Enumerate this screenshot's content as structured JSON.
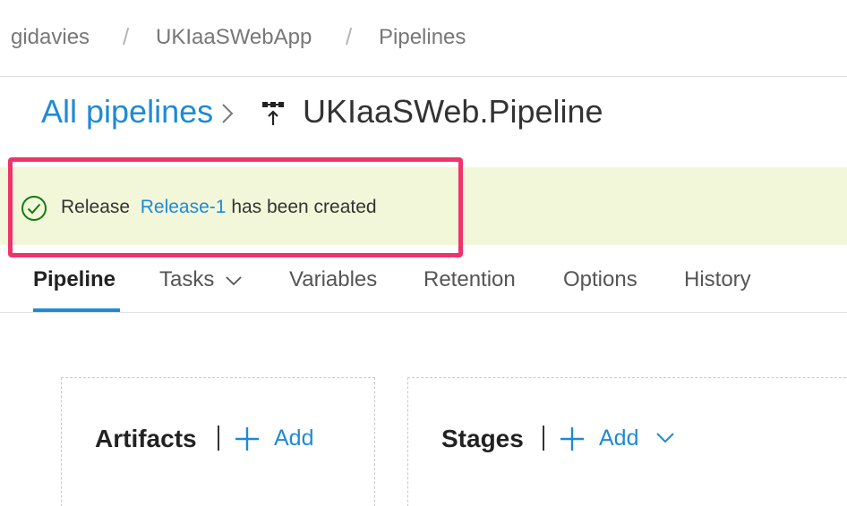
{
  "breadcrumb": {
    "items": [
      "gidavies",
      "UKIaaSWebApp",
      "Pipelines"
    ],
    "separator": "/"
  },
  "header": {
    "all_pipelines_label": "All pipelines",
    "pipeline_name": "UKIaaSWeb.Pipeline"
  },
  "banner": {
    "prefix": "Release",
    "release_link": "Release-1",
    "suffix": "has been created",
    "background_color": "#f3f7d9",
    "highlight_color": "#f0336b",
    "success_color": "#107c10"
  },
  "tabs": [
    {
      "label": "Pipeline",
      "active": true
    },
    {
      "label": "Tasks",
      "active": false,
      "has_dropdown": true
    },
    {
      "label": "Variables",
      "active": false
    },
    {
      "label": "Retention",
      "active": false
    },
    {
      "label": "Options",
      "active": false
    },
    {
      "label": "History",
      "active": false
    }
  ],
  "artifacts": {
    "title": "Artifacts",
    "add_label": "Add"
  },
  "stages": {
    "title": "Stages",
    "add_label": "Add"
  },
  "colors": {
    "accent": "#1e8ad6"
  },
  "icons": {
    "pipeline": "pipeline-icon",
    "success": "check-circle-icon",
    "add": "plus-icon",
    "dropdown": "chevron-down-icon",
    "breadcrumb_arrow": "chevron-right-icon"
  }
}
